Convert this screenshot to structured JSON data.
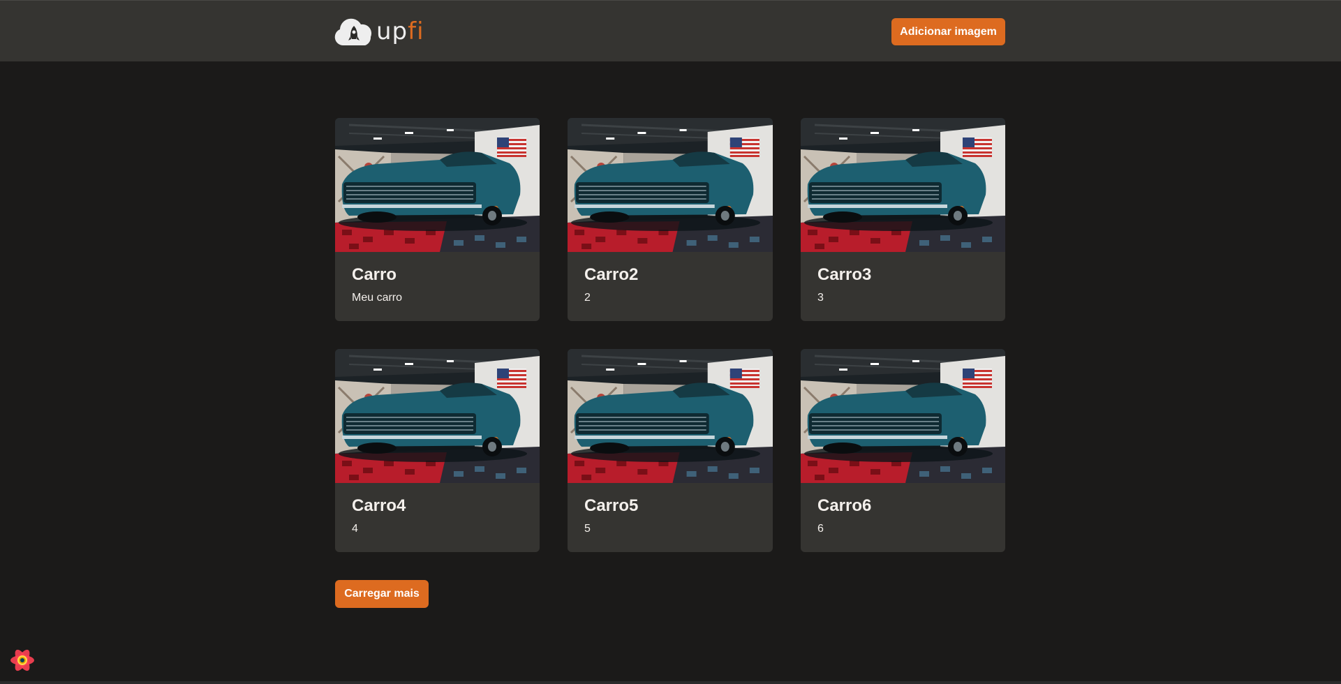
{
  "header": {
    "logo_text_main": "up",
    "logo_text_accent": "fi",
    "add_button_label": "Adicionar imagem"
  },
  "cards": [
    {
      "title": "Carro",
      "description": "Meu carro"
    },
    {
      "title": "Carro2",
      "description": "2"
    },
    {
      "title": "Carro3",
      "description": "3"
    },
    {
      "title": "Carro4",
      "description": "4"
    },
    {
      "title": "Carro5",
      "description": "5"
    },
    {
      "title": "Carro6",
      "description": "6"
    }
  ],
  "load_more_label": "Carregar mais",
  "icons": {
    "logo": "cloud-rocket-icon",
    "devtools": "react-query-devtools-icon"
  },
  "colors": {
    "background": "#1b1a19",
    "surface": "#353431",
    "accent": "#dd6b20",
    "text": "#f4f0ec"
  }
}
